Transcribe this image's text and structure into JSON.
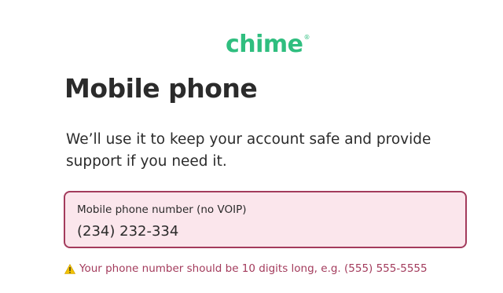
{
  "header": {
    "logo_text": "chime",
    "logo_mark": "®"
  },
  "main": {
    "title": "Mobile phone",
    "subtitle": "We’ll use it to keep your account safe and provide support if you need it.",
    "phone_field": {
      "label": "Mobile phone number (no VOIP)",
      "value": "(234) 232-334",
      "state": "error"
    },
    "error": {
      "icon": "warning-icon",
      "message": "Your phone number should be 10 digits long, e.g. (555) 555-5555"
    }
  },
  "colors": {
    "brand": "#2fbe7f",
    "error": "#a33b5c",
    "error_background": "#fbe6ec",
    "text": "#2b2b2b",
    "warning_icon": "#f2c200"
  }
}
